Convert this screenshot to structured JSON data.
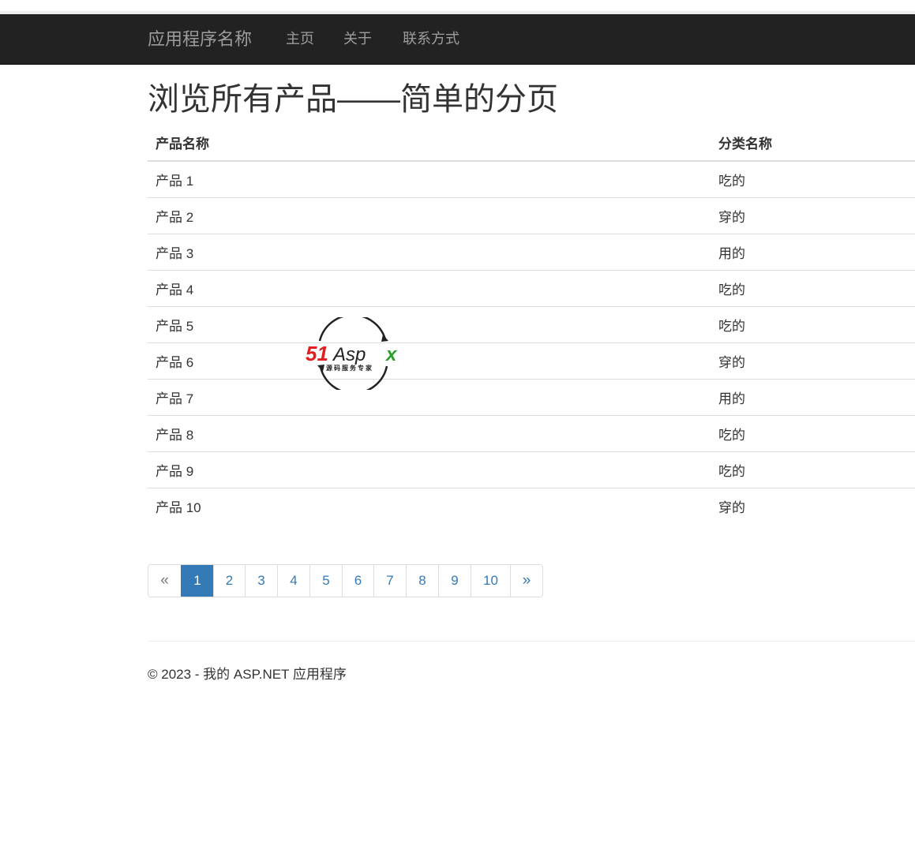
{
  "navbar": {
    "brand": "应用程序名称",
    "links": [
      "主页",
      "关于",
      "联系方式"
    ]
  },
  "page": {
    "title": "浏览所有产品——简单的分页"
  },
  "table": {
    "headers": [
      "产品名称",
      "分类名称"
    ],
    "rows": [
      [
        "产品 1",
        "吃的"
      ],
      [
        "产品 2",
        "穿的"
      ],
      [
        "产品 3",
        "用的"
      ],
      [
        "产品 4",
        "吃的"
      ],
      [
        "产品 5",
        "吃的"
      ],
      [
        "产品 6",
        "穿的"
      ],
      [
        "产品 7",
        "用的"
      ],
      [
        "产品 8",
        "吃的"
      ],
      [
        "产品 9",
        "吃的"
      ],
      [
        "产品 10",
        "穿的"
      ]
    ]
  },
  "pagination": {
    "prev": "«",
    "next": "»",
    "pages": [
      "1",
      "2",
      "3",
      "4",
      "5",
      "6",
      "7",
      "8",
      "9",
      "10"
    ],
    "current": "1"
  },
  "footer": {
    "text": "© 2023 - 我的 ASP.NET 应用程序"
  },
  "watermark": {
    "logo_text": "51Aspx",
    "tagline": "源码服务专家"
  },
  "colors": {
    "navbar_bg": "#222222",
    "nav_text": "#9d9d9d",
    "link": "#337ab7",
    "active_page_bg": "#337ab7",
    "logo_red": "#e02020",
    "logo_green": "#2aa02a"
  }
}
